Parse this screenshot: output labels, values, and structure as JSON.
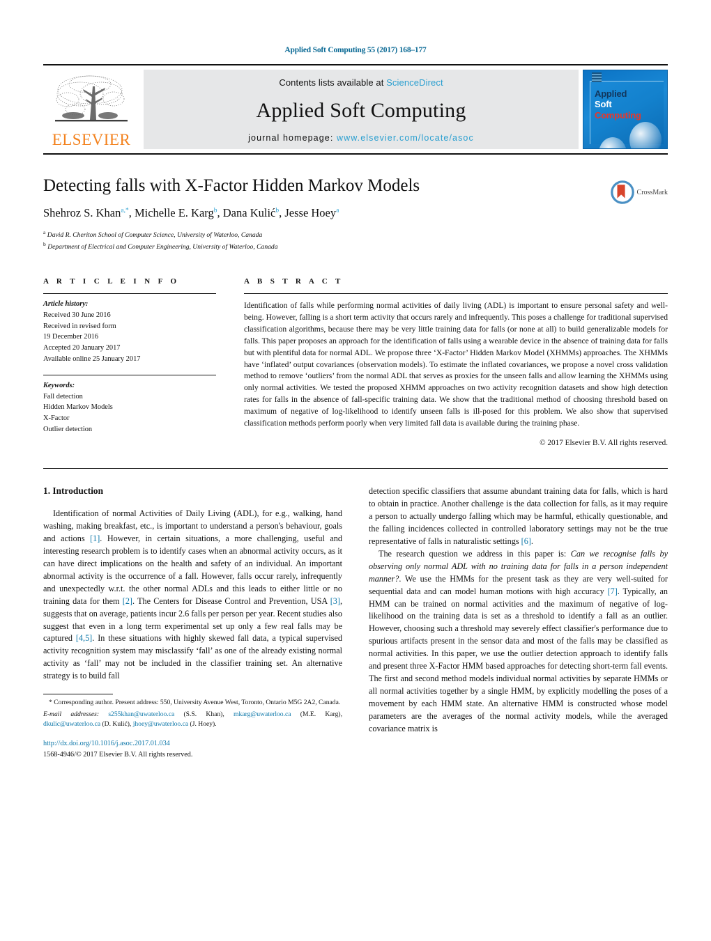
{
  "running_head": "Applied Soft Computing 55 (2017) 168–177",
  "masthead": {
    "publisher_wordmark": "ELSEVIER",
    "contents_prefix": "Contents lists available at ",
    "contents_link": "ScienceDirect",
    "journal_name": "Applied Soft Computing",
    "homepage_prefix": "journal homepage: ",
    "homepage_url": "www.elsevier.com/locate/asoc",
    "cover": {
      "line1": "Applied",
      "line2": "Soft",
      "line3": "Computing"
    }
  },
  "article": {
    "title": "Detecting falls with X-Factor Hidden Markov Models",
    "authors_html": "Shehroz S. Khan<sup>a,*</sup>, Michelle E. Karg<sup>b</sup>, Dana Kulić<sup>b</sup>, Jesse Hoey<sup>a</sup>",
    "affiliation_a": "David R. Cheriton School of Computer Science, University of Waterloo, Canada",
    "affiliation_b": "Department of Electrical and Computer Engineering, University of Waterloo, Canada",
    "crossmark_label": "CrossMark"
  },
  "article_info": {
    "heading": "A R T I C L E   I N F O",
    "history_label": "Article history:",
    "history": [
      "Received 30 June 2016",
      "Received in revised form",
      "19 December 2016",
      "Accepted 20 January 2017",
      "Available online 25 January 2017"
    ],
    "keywords_label": "Keywords:",
    "keywords": [
      "Fall detection",
      "Hidden Markov Models",
      "X-Factor",
      "Outlier detection"
    ]
  },
  "abstract": {
    "heading": "A B S T R A C T",
    "text": "Identification of falls while performing normal activities of daily living (ADL) is important to ensure personal safety and well-being. However, falling is a short term activity that occurs rarely and infrequently. This poses a challenge for traditional supervised classification algorithms, because there may be very little training data for falls (or none at all) to build generalizable models for falls. This paper proposes an approach for the identification of falls using a wearable device in the absence of training data for falls but with plentiful data for normal ADL. We propose three ‘X-Factor’ Hidden Markov Model (XHMMs) approaches. The XHMMs have ‘inflated’ output covariances (observation models). To estimate the inflated covariances, we propose a novel cross validation method to remove ‘outliers’ from the normal ADL that serves as proxies for the unseen falls and allow learning the XHMMs using only normal activities. We tested the proposed XHMM approaches on two activity recognition datasets and show high detection rates for falls in the absence of fall-specific training data. We show that the traditional method of choosing threshold based on maximum of negative of log-likelihood to identify unseen falls is ill-posed for this problem. We also show that supervised classification methods perform poorly when very limited fall data is available during the training phase.",
    "copyright": "© 2017 Elsevier B.V. All rights reserved."
  },
  "body": {
    "section_heading": "1.  Introduction",
    "left_paragraphs": [
      {
        "parts": [
          {
            "t": "Identification of normal Activities of Daily Living (ADL), for e.g., walking, hand washing, making breakfast, etc., is important to understand a person's behaviour, goals and actions "
          },
          {
            "t": "[1]",
            "ref": true
          },
          {
            "t": ". However, in certain situations, a more challenging, useful and interesting research problem is to identify cases when an abnormal activity occurs, as it can have direct implications on the health and safety of an individual. An important abnormal activity is the occurrence of a fall. However, falls occur rarely, infrequently and unexpectedly w.r.t. the other normal ADLs and this leads to either little or no training data for them "
          },
          {
            "t": "[2]",
            "ref": true
          },
          {
            "t": ". The Centers for Disease Control and Prevention, USA "
          },
          {
            "t": "[3]",
            "ref": true
          },
          {
            "t": ", suggests that on average, patients incur 2.6 falls per person per year. Recent studies also suggest that even in a long term experimental set up only a few real falls may be captured "
          },
          {
            "t": "[4,5]",
            "ref": true
          },
          {
            "t": ". In these situations with highly skewed fall data, a typical supervised activity recognition system may misclassify ‘fall’ as one of the already existing normal activity as ‘fall’ may not be included in the classifier training set. An alternative strategy is to build fall"
          }
        ]
      }
    ],
    "right_paragraphs": [
      {
        "parts": [
          {
            "t": "detection specific classifiers that assume abundant training data for falls, which is hard to obtain in practice. Another challenge is the data collection for falls, as it may require a person to actually undergo falling which may be harmful, ethically questionable, and the falling incidences collected in controlled laboratory settings may not be the true representative of falls in naturalistic settings "
          },
          {
            "t": "[6]",
            "ref": true
          },
          {
            "t": "."
          }
        ],
        "no_indent": true
      },
      {
        "parts": [
          {
            "t": "The research question we address in this paper is: "
          },
          {
            "t": "Can we recognise falls by observing only normal ADL with no training data for falls in a person independent manner?",
            "italic": true
          },
          {
            "t": ". We use the HMMs for the present task as they are very well-suited for sequential data and can model human motions with high accuracy "
          },
          {
            "t": "[7]",
            "ref": true
          },
          {
            "t": ". Typically, an HMM can be trained on normal activities and the maximum of negative of log-likelihood on the training data is set as a threshold to identify a fall as an outlier. However, choosing such a threshold may severely effect classifier's performance due to spurious artifacts present in the sensor data and most of the falls may be classified as normal activities. In this paper, we use the outlier detection approach to identify falls and present three X-Factor HMM based approaches for detecting short-term fall events. The first and second method models individual normal activities by separate HMMs or all normal activities together by a single HMM, by explicitly modelling the poses of a movement by each HMM state. An alternative HMM is constructed whose model parameters are the averages of the normal activity models, while the averaged covariance matrix is"
          }
        ]
      }
    ]
  },
  "footnote": {
    "corresponding": "* Corresponding author. Present address: 550, University Avenue West, Toronto, Ontario M5G 2A2, Canada.",
    "email_label": "E-mail addresses:",
    "emails": [
      {
        "addr": "s255khan@uwaterloo.ca",
        "name": " (S.S. Khan), "
      },
      {
        "addr": "mkarg@uwaterloo.ca",
        "name": " (M.E. Karg), "
      },
      {
        "addr": "dkulic@uwaterloo.ca",
        "name": " (D. Kulić), "
      },
      {
        "addr": "jhoey@uwaterloo.ca",
        "name": " (J. Hoey)."
      }
    ],
    "doi": "http://dx.doi.org/10.1016/j.asoc.2017.01.034",
    "issn_line": "1568-4946/© 2017 Elsevier B.V. All rights reserved."
  },
  "colors": {
    "link_blue": "#0b76a8",
    "science_direct_blue": "#2a9fd0",
    "elsevier_orange": "#F3821E",
    "cover_blue": "#1381cd",
    "cover_red": "#e8372a"
  }
}
